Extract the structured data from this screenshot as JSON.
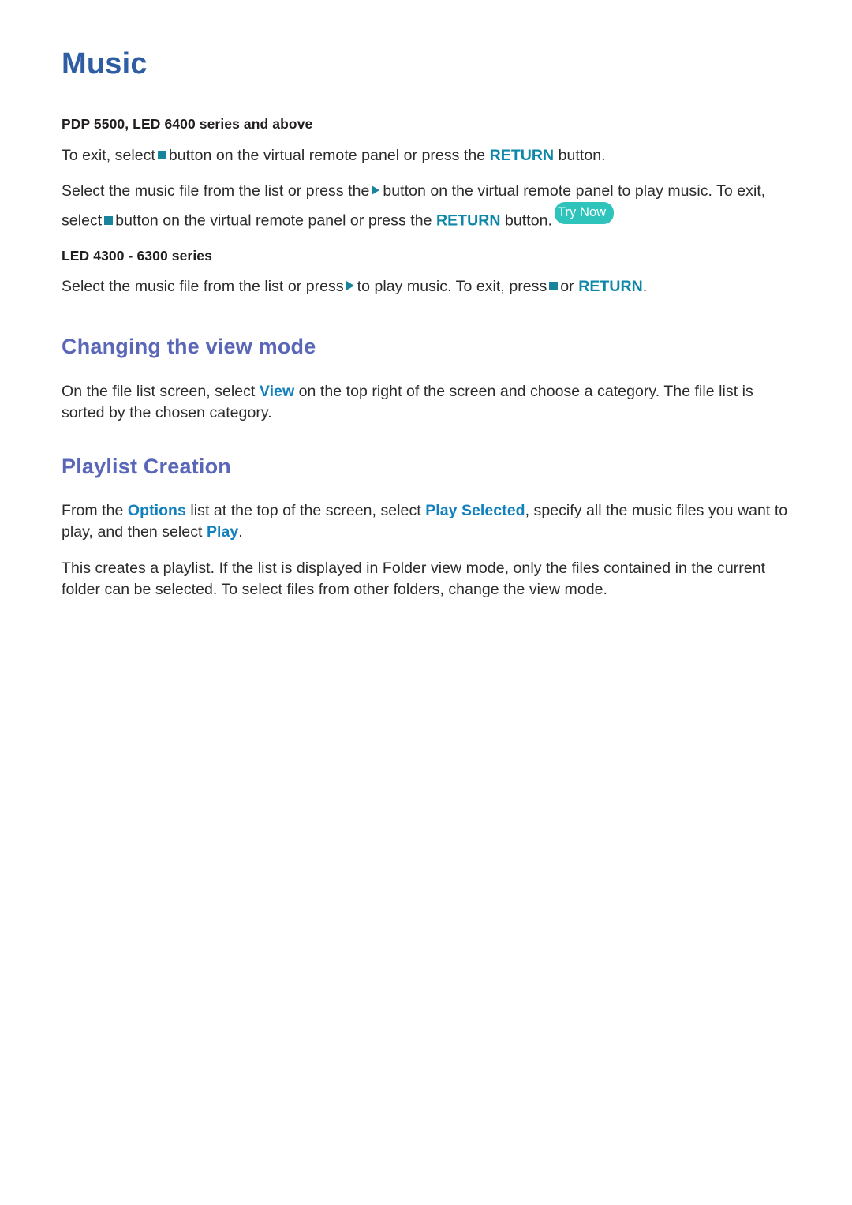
{
  "page": {
    "title": "Music"
  },
  "music_section": {
    "subhead_1": "PDP 5500, LED 6400 series and above",
    "para_1": {
      "pre": "To exit, select",
      "mid": "button on the virtual remote panel or press the",
      "keyword": "RETURN",
      "post": "button."
    },
    "para_2": {
      "pre": "Select the music file from the list or press the",
      "mid_1": "button on the virtual remote panel to play music. To exit, select",
      "mid_2": "button on the virtual remote panel or press the",
      "keyword": "RETURN",
      "post": "button.",
      "badge": "Try Now"
    },
    "subhead_2": "LED 4300 - 6300 series",
    "para_3": {
      "pre": "Select the music file from the list or press",
      "mid_1": "to play music. To exit, press",
      "mid_2": "or",
      "keyword": "RETURN",
      "post": "."
    }
  },
  "view_mode_section": {
    "heading": "Changing the view mode",
    "para": {
      "pre": "On the file list screen, select",
      "keyword": "View",
      "post": "on the top right of the screen and choose a category. The file list is sorted by the chosen category."
    }
  },
  "playlist_section": {
    "heading": "Playlist Creation",
    "para_1": {
      "pre": "From the",
      "keyword_1": "Options",
      "mid_1": "list at the top of the screen, select",
      "keyword_2": "Play Selected",
      "mid_2": ", specify all the music files you want to play, and then select",
      "keyword_3": "Play",
      "post": "."
    },
    "para_2": "This creates a playlist. If the list is displayed in Folder view mode, only the files contained in the current folder can be selected. To select files from other folders, change the view mode."
  },
  "colors": {
    "page_title": "#2f5da4",
    "section_heading": "#5a67b8",
    "keyword_blue": "#1180bd",
    "keyword_teal": "#0d87a8",
    "glyph_teal": "#17849c",
    "badge_bg": "#2ec4bc",
    "body_text": "#2b2b2b"
  },
  "icons": {
    "stop": "stop-square-icon",
    "play": "play-triangle-icon"
  }
}
